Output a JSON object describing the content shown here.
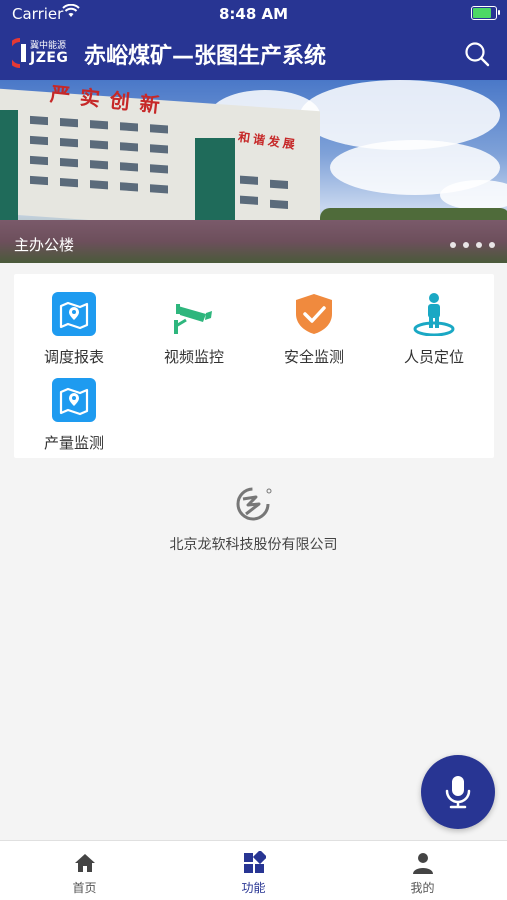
{
  "status_bar": {
    "carrier": "Carrier",
    "time": "8:48 AM"
  },
  "header": {
    "logo_cn": "冀中能源",
    "logo_en": "JZEG",
    "title": "赤峪煤矿—张图生产系统"
  },
  "banner": {
    "caption": "主办公楼",
    "slide_count": 4,
    "active_slide": 1,
    "sign_text_1": "严实创新",
    "sign_text_2": "和谐发展"
  },
  "functions": [
    {
      "label": "调度报表",
      "icon": "map-pin-icon",
      "color": "#1e9bf0"
    },
    {
      "label": "视频监控",
      "icon": "camera-icon",
      "color": "#2eb67d"
    },
    {
      "label": "安全监测",
      "icon": "shield-check-icon",
      "color": "#f08a3e"
    },
    {
      "label": "人员定位",
      "icon": "person-location-icon",
      "color": "#1aa8c4"
    },
    {
      "label": "产量监测",
      "icon": "map-pin-icon",
      "color": "#1e9bf0"
    }
  ],
  "company": {
    "name": "北京龙软科技股份有限公司"
  },
  "tabs": [
    {
      "label": "首页",
      "icon": "home-icon",
      "active": false
    },
    {
      "label": "功能",
      "icon": "grid-icon",
      "active": true
    },
    {
      "label": "我的",
      "icon": "user-icon",
      "active": false
    }
  ],
  "colors": {
    "primary": "#283593",
    "background": "#f4f4f4"
  }
}
